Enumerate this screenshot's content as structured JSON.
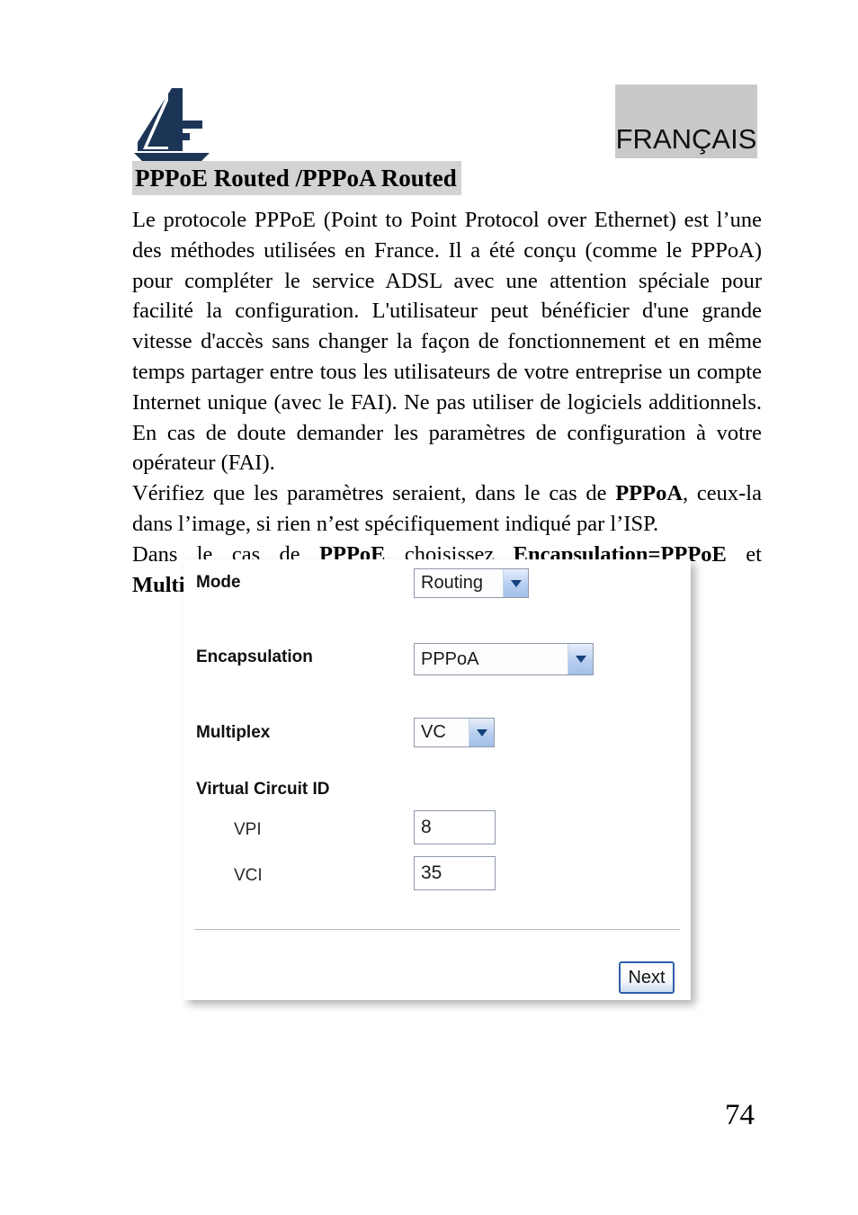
{
  "header": {
    "logo_icon": "atlantis-sailboat-logo",
    "language_badge": "FRANÇAIS",
    "badge_bg": "#c9c9c9",
    "logo_color": "#1c3557"
  },
  "section": {
    "title": "PPPoE Routed /PPPoA Routed",
    "title_highlight_bg": "#d3d3d3"
  },
  "body": {
    "paragraph_1": " Le protocole PPPoE (Point to Point Protocol over Ethernet) est l’une des méthodes utilisées en France. Il a été conçu (comme le PPPoA) pour compléter le service ADSL avec une attention spéciale pour facilité la configuration. L'utilisateur peut bénéficier d'une grande vitesse d'accès sans changer la façon de fonctionnement et en même temps partager entre tous les utilisateurs de votre entreprise un compte Internet unique (avec le FAI). Ne pas utiliser  de logiciels additionnels. En cas de doute demander les paramètres de configuration à votre opérateur (FAI).",
    "paragraph_2_pre": "Vérifiez  que les paramètres seraient, dans le cas de ",
    "paragraph_2_bold": "PPPoA",
    "paragraph_2_post": ", ceux-la dans l’image, si rien n’est spécifiquement indiqué par l’ISP.",
    "paragraph_3_pre": "Dans le cas de ",
    "paragraph_3_bold_1": "PPPoE",
    "paragraph_3_mid": " choisissez ",
    "paragraph_3_bold_2": "Encapsulation=PPPoE",
    "paragraph_3_post": " et ",
    "paragraph_3_bold_3": "Multiplex=LLC",
    "paragraph_3_end": "."
  },
  "router_panel": {
    "fields": {
      "mode": {
        "label": "Mode",
        "value": "Routing"
      },
      "encapsulation": {
        "label": "Encapsulation",
        "value": "PPPoA"
      },
      "multiplex": {
        "label": "Multiplex",
        "value": "VC"
      },
      "virtual_circuit_id": {
        "label": "Virtual Circuit ID"
      },
      "vpi": {
        "label": "VPI",
        "value": "8"
      },
      "vci": {
        "label": "VCI",
        "value": "35"
      }
    },
    "next_button": "Next",
    "dropdown_arrow_icon": "chevron-down-icon",
    "accent_blue": "#2f5fa8"
  },
  "footer": {
    "page_number": "74"
  }
}
